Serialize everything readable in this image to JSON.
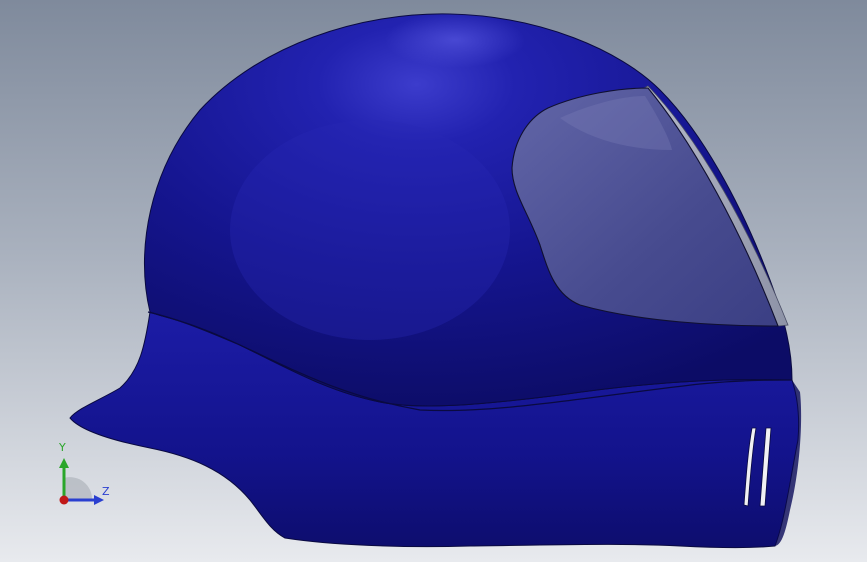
{
  "viewport": {
    "background_top": "#7f8a9c",
    "background_bottom": "#e6e8ec",
    "model": {
      "body_color": "#1a1aa0",
      "visor_color": "#5a5f9c",
      "edge_color": "#0a0a40"
    }
  },
  "triad": {
    "y_label": "Y",
    "z_label": "Z",
    "y_color": "#2aa62a",
    "z_color": "#2a3fd0",
    "x_color": "#c01818"
  }
}
